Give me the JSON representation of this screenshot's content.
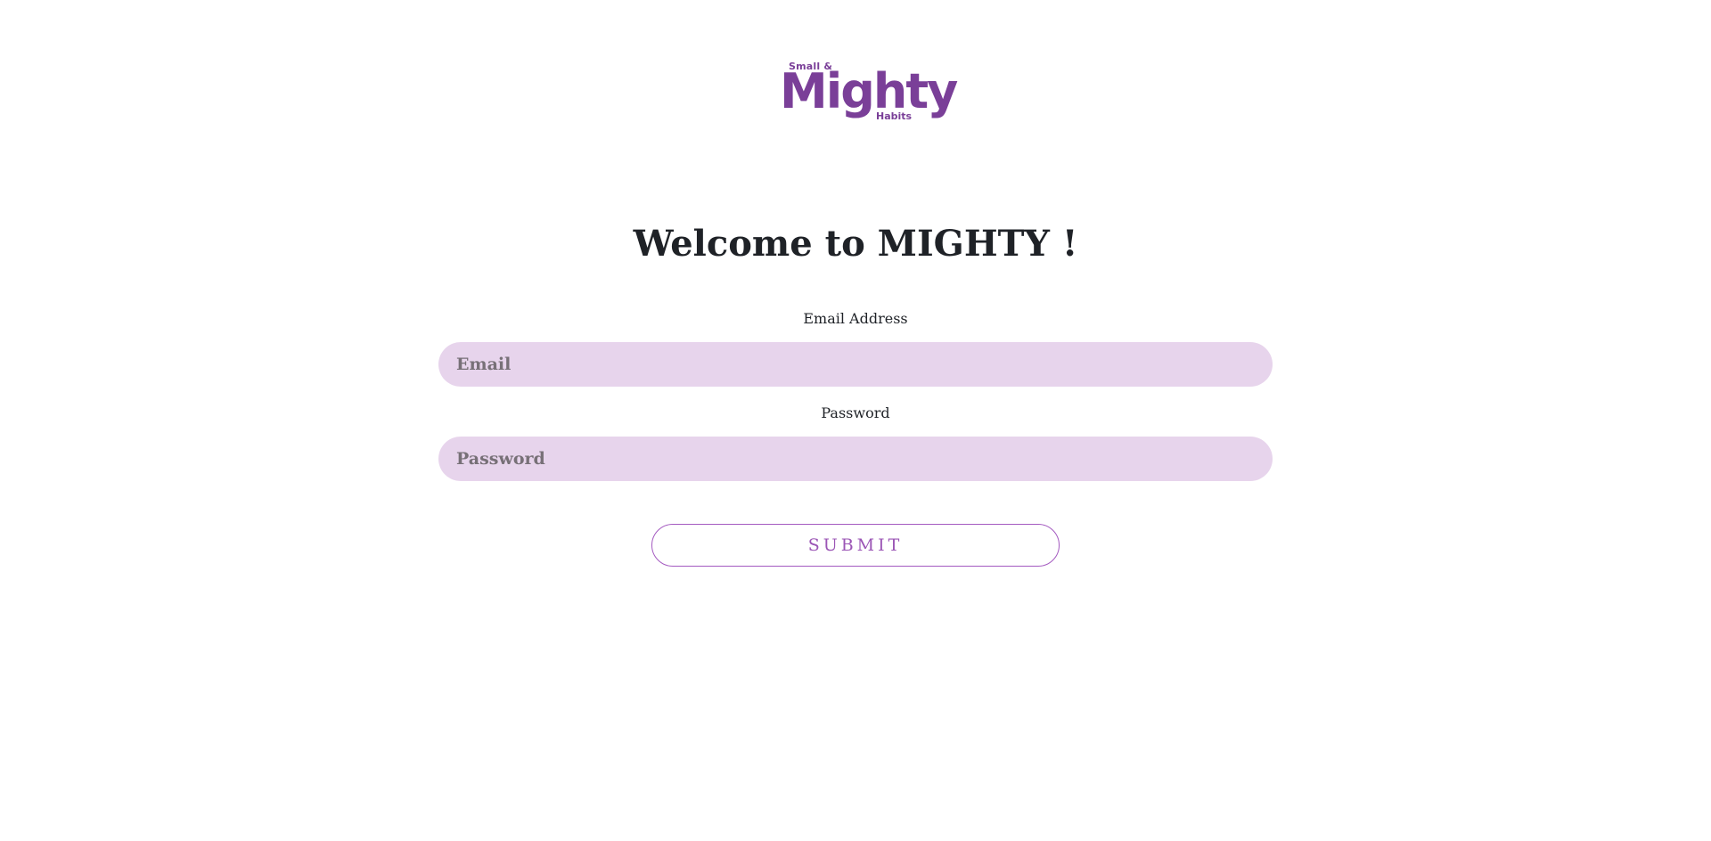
{
  "logo": {
    "line1": "Small &",
    "line2": "Mighty",
    "line3": "Habits",
    "color": "#7a3f98"
  },
  "heading": "Welcome to MIGHTY !",
  "form": {
    "email_label": "Email Address",
    "email_placeholder": "Email",
    "email_value": "",
    "password_label": "Password",
    "password_placeholder": "Password",
    "password_value": "",
    "submit_label": "SUBMIT"
  },
  "colors": {
    "input_background": "#e7d4ec",
    "accent": "#9b55b5",
    "heading_text": "#1f2227"
  }
}
